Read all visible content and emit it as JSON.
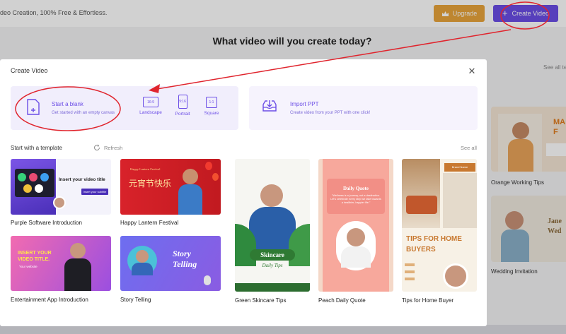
{
  "header": {
    "tagline": "deo Creation, 100% Free & Effortless.",
    "upgrade_label": "Upgrade",
    "create_label": "Create Video"
  },
  "page": {
    "heading": "What video will you create today?",
    "see_all": "See all te",
    "right_cards": [
      {
        "label": "Orange Working Tips",
        "text": "MA A F"
      },
      {
        "label": "Wedding Invitation",
        "text": "Jane Wed"
      }
    ]
  },
  "modal": {
    "title": "Create Video",
    "blank": {
      "title": "Start a blank",
      "subtitle": "Get started with an empty canvas"
    },
    "ratios": [
      {
        "label": "Landscape",
        "ratio": "16:9"
      },
      {
        "label": "Portrait",
        "ratio": "9:16"
      },
      {
        "label": "Square",
        "ratio": "1:1"
      }
    ],
    "ppt": {
      "title": "Import PPT",
      "subtitle": "Create video from your PPT with one click!"
    },
    "template_heading": "Start with a template",
    "refresh_label": "Refresh",
    "see_all_label": "See all",
    "templates": [
      {
        "label": "Purple Software Introduction",
        "thumb_title": "Insert your video title",
        "thumb_sub": "Insert your subtitle"
      },
      {
        "label": "Happy Lantern Festival",
        "thumb_title": "元宵节快乐",
        "thumb_sub": "Happy Lantern Festival"
      },
      {
        "label": "Entertainment App Introduction",
        "thumb_title": "INSERT YOUR VIDEO TITLE.",
        "thumb_sub": "Your website"
      },
      {
        "label": "Story Telling",
        "thumb_title": "Story Telling",
        "thumb_sub": ""
      },
      {
        "label": "Green Skincare Tips",
        "thumb_title": "Skincare",
        "thumb_sub": "Daily Tips"
      },
      {
        "label": "Peach Daily Quote",
        "thumb_title": "Daily Quote",
        "thumb_sub": "\"Wellness is a journey, not a destination. Let's celebrate every step we take towards a healthier, happier life.\""
      },
      {
        "label": "Tips for Home Buyer",
        "thumb_title": "TIPS FOR HOME BUYERS",
        "thumb_sub": "Brand Name"
      }
    ]
  },
  "colors": {
    "accent": "#6b4de6",
    "upgrade": "#e8a43b",
    "annotation": "#e0242d"
  }
}
